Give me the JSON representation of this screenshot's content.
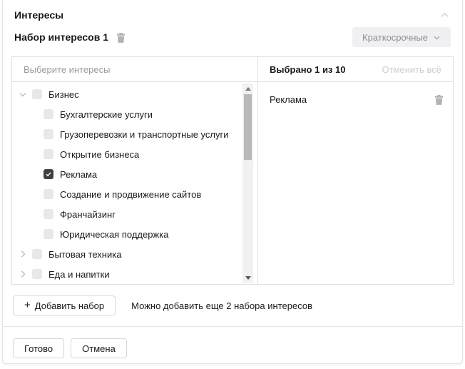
{
  "panel": {
    "title": "Интересы",
    "collapse_icon": "chevron-up-icon"
  },
  "interest_set": {
    "name": "Набор интересов 1",
    "delete_icon": "trash-icon",
    "type_dropdown": {
      "selected": "Краткосрочные",
      "icon": "chevron-down-icon"
    }
  },
  "picker": {
    "search_placeholder": "Выберите интересы",
    "selected_header": "Выбрано 1 из 10",
    "clear_all_label": "Отменить всё",
    "tree": [
      {
        "label": "Бизнес",
        "level": 0,
        "expandable": true,
        "expanded": true,
        "checked": false
      },
      {
        "label": "Бухгалтерские услуги",
        "level": 1,
        "checked": false
      },
      {
        "label": "Грузоперевозки и транспортные услуги",
        "level": 1,
        "checked": false
      },
      {
        "label": "Открытие бизнеса",
        "level": 1,
        "checked": false
      },
      {
        "label": "Реклама",
        "level": 1,
        "checked": true
      },
      {
        "label": "Создание и продвижение сайтов",
        "level": 1,
        "checked": false
      },
      {
        "label": "Франчайзинг",
        "level": 1,
        "checked": false
      },
      {
        "label": "Юридическая поддержка",
        "level": 1,
        "checked": false
      },
      {
        "label": "Бытовая техника",
        "level": 0,
        "expandable": true,
        "expanded": false,
        "checked": false
      },
      {
        "label": "Еда и напитки",
        "level": 0,
        "expandable": true,
        "expanded": false,
        "checked": false
      }
    ],
    "selected_items": [
      {
        "label": "Реклама",
        "remove_icon": "trash-icon"
      }
    ]
  },
  "footer": {
    "add_icon": "+",
    "add_button_label": "Добавить набор",
    "hint": "Можно добавить еще 2 набора интересов"
  },
  "actions": {
    "done_label": "Готово",
    "cancel_label": "Отмена"
  },
  "colors": {
    "border": "#e0e0e0",
    "checkbox_unchecked": "#e8e8e8",
    "checkbox_checked": "#404040",
    "muted_text": "#9a9a9a",
    "disabled_text": "#cecece",
    "dropdown_bg": "#f0f0f2",
    "scrollbar_thumb": "#b9b9b9"
  }
}
